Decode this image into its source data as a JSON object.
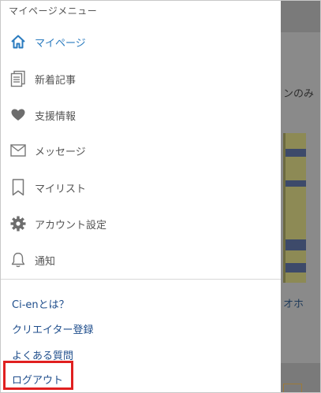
{
  "background": {
    "visible_text_right": "ンのみ",
    "visible_text_lower": "オホ"
  },
  "drawer": {
    "title": "マイページメニュー",
    "items": [
      {
        "label": "マイページ",
        "icon": "home-icon",
        "active": true
      },
      {
        "label": "新着記事",
        "icon": "document-icon",
        "active": false
      },
      {
        "label": "支援情報",
        "icon": "heart-icon",
        "active": false
      },
      {
        "label": "メッセージ",
        "icon": "mail-icon",
        "active": false
      },
      {
        "label": "マイリスト",
        "icon": "bookmark-icon",
        "active": false
      },
      {
        "label": "アカウント設定",
        "icon": "gear-icon",
        "active": false
      },
      {
        "label": "通知",
        "icon": "bell-icon",
        "active": false
      }
    ],
    "links": [
      {
        "label": "Ci-enとは？"
      },
      {
        "label": "クリエイター登録"
      },
      {
        "label": "よくある質問"
      },
      {
        "label": "ログアウト"
      }
    ]
  },
  "colors": {
    "accent": "#2a7bbf",
    "link": "#1f4e8c",
    "text": "#555555",
    "highlight": "#e02020",
    "overlay": "#7a7a7a"
  }
}
